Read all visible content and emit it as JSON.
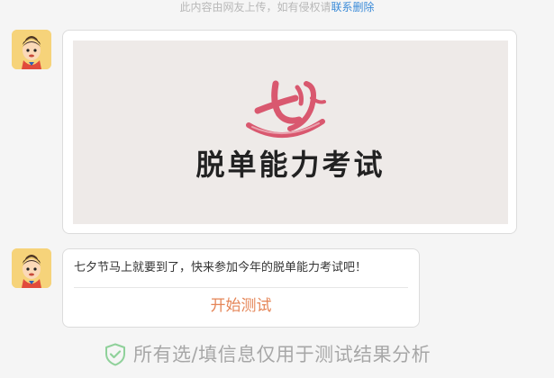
{
  "notice": {
    "text": "此内容由网友上传，如有侵权请",
    "link": "联系删除"
  },
  "messages": [
    {
      "avatar_icon": "cartoon-boy-avatar-icon",
      "poster": {
        "logo_icon": "qixi-calligraphy-logo-icon",
        "title": "脱单能力考试"
      }
    },
    {
      "avatar_icon": "cartoon-boy-avatar-icon",
      "text": "七夕节马上就要到了，快来参加今年的脱单能力考试吧！",
      "button": "开始测试"
    }
  ],
  "footer": {
    "icon": "shield-check-icon",
    "text": "所有选/填信息仅用于测试结果分析"
  },
  "colors": {
    "background": "#f5f5f5",
    "link": "#3b8bd8",
    "button_text": "#e58557",
    "logo": "#d9586f",
    "shield": "#8fd19a"
  }
}
